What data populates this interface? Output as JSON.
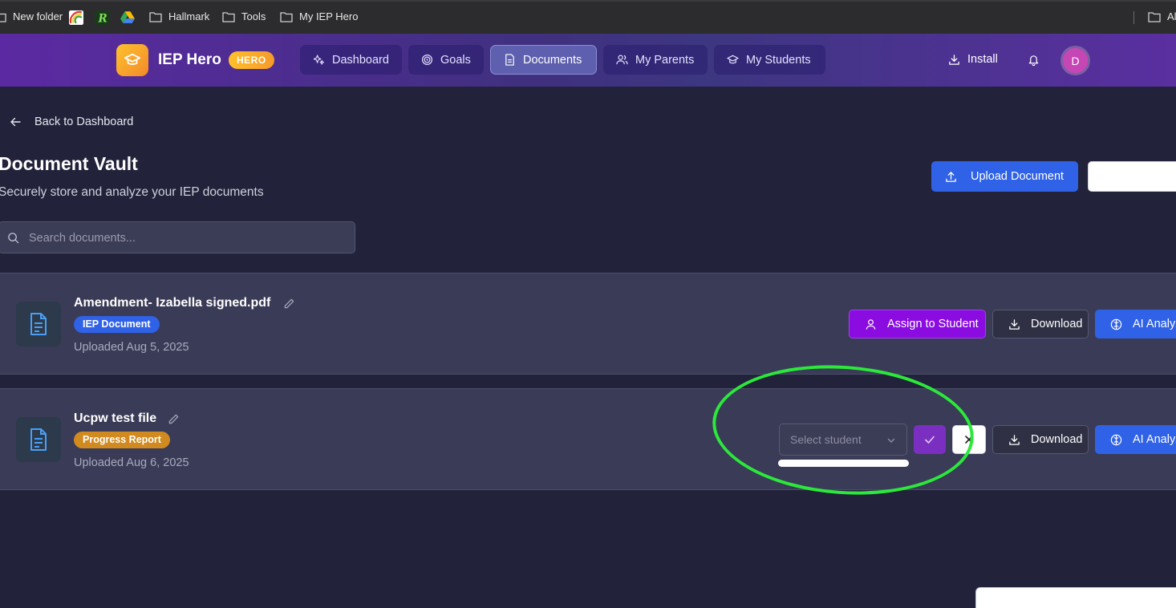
{
  "bookmarks": [
    {
      "label": "New folder",
      "icon": "folder-icon"
    },
    {
      "label": "",
      "icon": "rainbow-icon"
    },
    {
      "label": "",
      "icon": "r-logo-icon"
    },
    {
      "label": "",
      "icon": "drive-icon"
    },
    {
      "label": "Hallmark",
      "icon": "folder-icon"
    },
    {
      "label": "Tools",
      "icon": "folder-icon"
    },
    {
      "label": "My IEP Hero",
      "icon": "folder-icon"
    },
    {
      "label": "Al",
      "icon": "folder-icon"
    }
  ],
  "header": {
    "brand": "IEP Hero",
    "badge": "HERO",
    "nav": [
      {
        "label": "Dashboard",
        "icon": "sparkles-icon",
        "active": false
      },
      {
        "label": "Goals",
        "icon": "target-icon",
        "active": false
      },
      {
        "label": "Documents",
        "icon": "document-icon",
        "active": true
      },
      {
        "label": "My Parents",
        "icon": "users-icon",
        "active": false
      },
      {
        "label": "My Students",
        "icon": "graduation-cap-icon",
        "active": false
      }
    ],
    "install_label": "Install",
    "avatar_initial": "D"
  },
  "main": {
    "back_label": "Back to Dashboard",
    "title": "Document Vault",
    "subtitle": "Securely store and analyze your IEP documents",
    "upload_label": "Upload Document",
    "search_placeholder": "Search documents..."
  },
  "documents": [
    {
      "name": "Amendment- Izabella signed.pdf",
      "tag": "IEP Document",
      "tag_color": "#2f62e6",
      "uploaded": "Uploaded Aug 5, 2025",
      "assign_label": "Assign to Student",
      "download_label": "Download",
      "ai_label": "AI Analyze"
    },
    {
      "name": "Ucpw test file",
      "tag": "Progress Report",
      "tag_color": "#d18a1f",
      "uploaded": "Uploaded Aug 6, 2025",
      "select_placeholder": "Select student",
      "download_label": "Download",
      "ai_label": "AI Analyze"
    }
  ],
  "colors": {
    "accent": "#2f62e6",
    "assign": "#8a0ce0",
    "highlight": "#2be93a"
  }
}
